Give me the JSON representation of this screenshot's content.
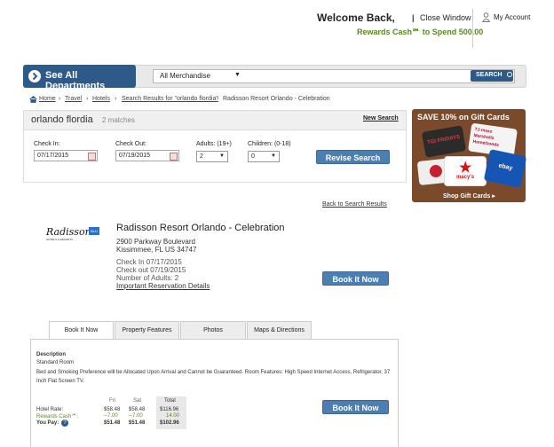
{
  "header": {
    "welcome": "Welcome Back,",
    "separator": "|",
    "close_window": "Close Window",
    "rewards_line": "Rewards Cash℠ to Spend 500.00",
    "my_account": "My Account"
  },
  "nav": {
    "see_all": "See All Departments",
    "merch_select": "All Merchandise",
    "search_button": "SEARCH"
  },
  "breadcrumb": [
    "Home",
    "Travel",
    "Hotels",
    "Search Results for \"orlando flordia\"",
    "Radisson Resort Orlando - Celebration"
  ],
  "search_panel": {
    "city": "orlando flordia",
    "matches": "2 matches",
    "new_search": "New Search",
    "check_in_label": "Check In:",
    "check_in_value": "07/17/2015",
    "check_out_label": "Check Out:",
    "check_out_value": "07/19/2015",
    "adults_label": "Adults: (19+)",
    "adults_value": "2",
    "children_label": "Children: (0-18)",
    "children_value": "0",
    "revise_button": "Revise Search"
  },
  "ad": {
    "title": "SAVE 10% on Gift Cards",
    "shop_link": "Shop Gift Cards ▸",
    "card_brands": [
      "TGI FRIDAYS",
      "TJ·maxx Marshalls HomeGoods",
      "macy's",
      "ebay"
    ]
  },
  "back_to_results": "Back to Search Results",
  "hotel": {
    "logo_text": "Radisson",
    "logo_sub": "HOTELS & RESORTS",
    "logo_badge": "BLU",
    "name": "Radisson Resort Orlando - Celebration",
    "address1": "2900 Parkway Boulevard",
    "address2": "Kissimmee, FL US 34747",
    "check_in": "Check In 07/17/2015",
    "check_out": "Check out 07/19/2015",
    "adults": "Number of Adults: 2",
    "important": "Important Reservation Details",
    "book_button": "Book It Now"
  },
  "tabs": [
    "Book It Now",
    "Property Features",
    "Photos",
    "Maps & Directions"
  ],
  "room": {
    "desc_heading": "Description",
    "room_type": "Standard Room",
    "details": "Bed and Smoking Preference will be Allocated Upon Arrival and Cannot be Guaranteed. Room Features: High Speed Internet Access, Refrigerator, 37 Inch Flat Screen TV.",
    "price_headers": [
      "Fri",
      "Sat",
      "Total"
    ],
    "rows": [
      {
        "label": "Hotel Rate:",
        "fri": "$58.48",
        "sat": "$58.48",
        "total": "$116.96"
      },
      {
        "label": "Rewards Cash℠:",
        "fri": "--7.00",
        "sat": "--7.00",
        "total": "14.00"
      },
      {
        "label": "You Pay:",
        "fri": "$51.48",
        "sat": "$51.48",
        "total": "$102.96"
      }
    ],
    "book_button": "Book It Now"
  },
  "colors": {
    "brand_blue": "#2d5a88",
    "button_blue": "#4c7fb1",
    "rewards_green": "#5a8a1f"
  }
}
